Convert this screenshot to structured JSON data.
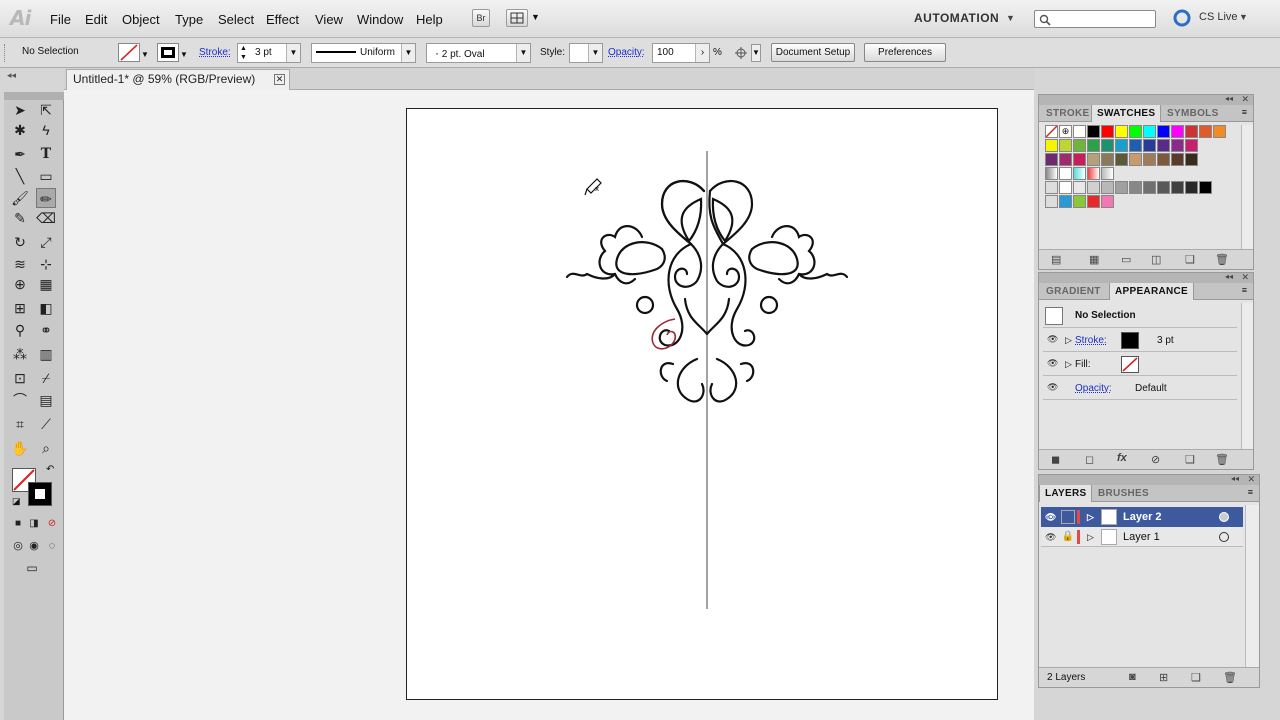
{
  "app": {
    "logo": "Ai"
  },
  "menu": [
    "File",
    "Edit",
    "Object",
    "Type",
    "Select",
    "Effect",
    "View",
    "Window",
    "Help"
  ],
  "menubar": {
    "bridge_label": "Br",
    "workspace": "AUTOMATION",
    "cs_live": "CS Live"
  },
  "control": {
    "selection": "No Selection",
    "stroke_label": "Stroke:",
    "stroke_value": "3 pt",
    "profile": "Uniform",
    "brush": "2 pt. Oval",
    "style_label": "Style:",
    "opacity_label": "Opacity:",
    "opacity_value": "100",
    "percent": "%",
    "document_setup": "Document Setup",
    "preferences": "Preferences"
  },
  "document": {
    "tab_title": "Untitled-1* @ 59% (RGB/Preview)"
  },
  "swatches_panel": {
    "tabs": [
      "STROKE",
      "SWATCHES",
      "SYMBOLS"
    ],
    "row1": [
      "#ffffff",
      "#000000",
      "#ff0000",
      "#ffff00",
      "#00ff00",
      "#00ffff",
      "#0000ff",
      "#ff00ff",
      "#cc3333",
      "#e05a2a",
      "#f08c28"
    ],
    "row2": [
      "#f5f500",
      "#bcd632",
      "#70b43c",
      "#2ea04a",
      "#1f9070",
      "#1aa0c8",
      "#1e5fb4",
      "#2a3a9a",
      "#5a2a8a",
      "#8a2a8a",
      "#c81e6e"
    ],
    "row3": [
      "#6e2a6e",
      "#a02a6e",
      "#c81e5a",
      "#b4a07a",
      "#8a7a5a",
      "#5a5a3a",
      "#c89a6e",
      "#a07a5a",
      "#7a5a3a",
      "#5a3a2a",
      "#3a2a1a"
    ],
    "row4": [
      "#ffffff",
      "#e8e8e8",
      "#d0d0d0",
      "#b8b8b8",
      "#a0a0a0",
      "#888888",
      "#707070",
      "#585858",
      "#404040",
      "#282828",
      "#000000"
    ],
    "row5": [
      "#2a9ad6",
      "#8ac83a",
      "#e8282a",
      "#f078b4"
    ]
  },
  "appearance_panel": {
    "tabs": [
      "GRADIENT",
      "APPEARANCE"
    ],
    "title": "No Selection",
    "stroke_label": "Stroke:",
    "stroke_value": "3 pt",
    "fill_label": "Fill:",
    "opacity_label": "Opacity:",
    "opacity_value": "Default"
  },
  "layers_panel": {
    "tabs": [
      "LAYERS",
      "BRUSHES"
    ],
    "layers": [
      {
        "name": "Layer 2",
        "selected": true
      },
      {
        "name": "Layer 1",
        "selected": false
      }
    ],
    "count": "2 Layers"
  },
  "colors": {
    "accent": "#3d5a9e",
    "link": "#1b2fc9"
  }
}
